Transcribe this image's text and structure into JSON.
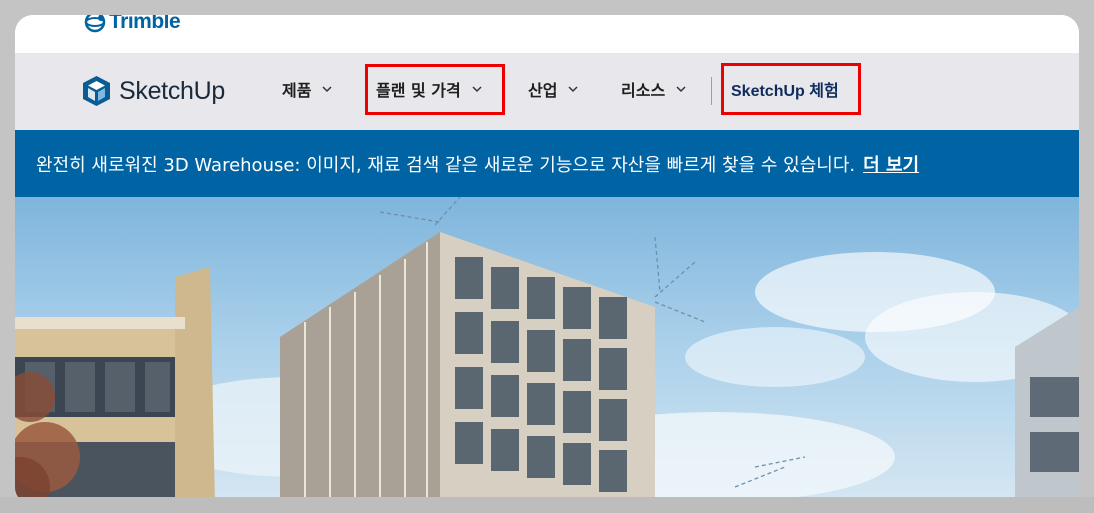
{
  "trimble": {
    "name": "Trimble"
  },
  "brand": {
    "name": "SketchUp"
  },
  "nav": {
    "items": [
      {
        "label": "제품"
      },
      {
        "label": "플랜 및 가격"
      },
      {
        "label": "산업"
      },
      {
        "label": "리소스"
      }
    ],
    "cta": {
      "brand": "SketchUp",
      "label": "체험"
    }
  },
  "banner": {
    "text": "완전히 새로워진 3D Warehouse: 이미지, 재료 검색 같은 새로운 기능으로 자산을 빠르게 찾을 수 있습니다.",
    "link": "더 보기"
  },
  "colors": {
    "accent": "#0063a3",
    "highlight": "#ec0000",
    "nav_bg": "#e8e7ec"
  }
}
